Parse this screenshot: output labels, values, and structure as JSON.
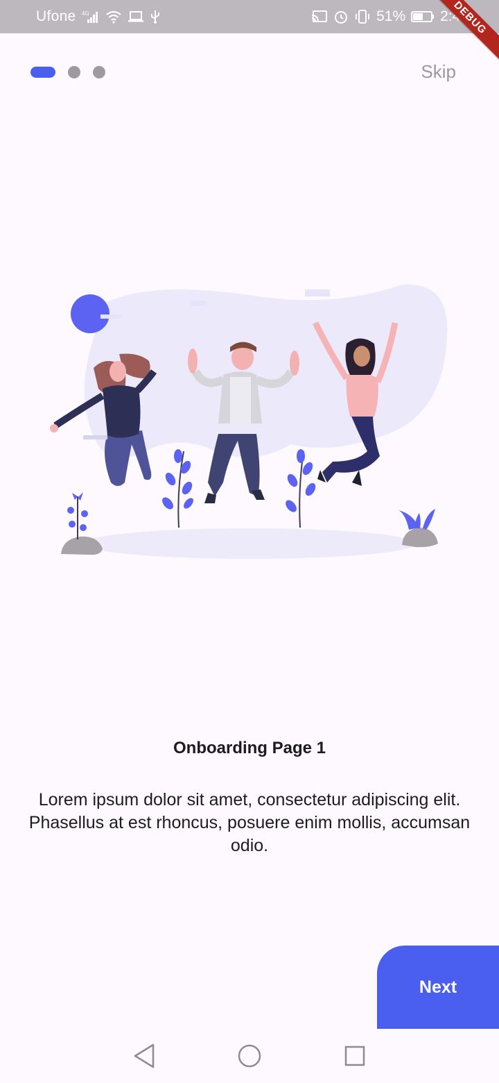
{
  "status_bar": {
    "carrier": "Ufone",
    "network_type": "4G",
    "battery_percent": "51%",
    "time": "2:46",
    "icons_left": [
      "signal-icon",
      "wifi-icon",
      "laptop-icon",
      "usb-icon"
    ],
    "icons_right": [
      "cast-icon",
      "alarm-icon",
      "vibrate-icon",
      "battery-icon"
    ]
  },
  "debug_banner": "DEBUG",
  "onboarding": {
    "page_count": 3,
    "current_page_index": 0,
    "skip_label": "Skip",
    "title": "Onboarding Page 1",
    "body": "Lorem ipsum dolor sit amet, consectetur adipiscing elit. Phasellus at est rhoncus, posuere enim mollis, accumsan odio.",
    "next_label": "Next"
  },
  "colors": {
    "accent": "#4a5ff0",
    "background": "#fdf9ff",
    "inactive_dot": "#9e9a9f",
    "status_bar": "#bdb8be"
  },
  "nav_bar": {
    "buttons": [
      "back-icon",
      "home-icon",
      "recents-icon"
    ]
  }
}
